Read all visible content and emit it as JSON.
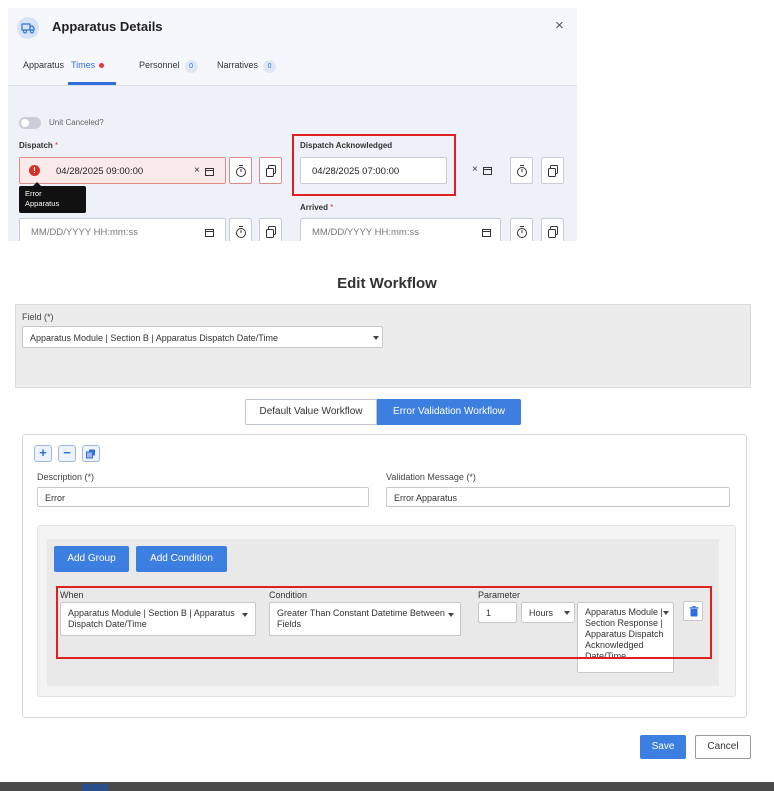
{
  "apparatus_details": {
    "title": "Apparatus Details",
    "close_glyph": "×",
    "tabs": [
      {
        "label": "Apparatus"
      },
      {
        "label": "Times"
      },
      {
        "label": "Personnel",
        "badge": "0"
      },
      {
        "label": "Narratives",
        "badge": "0"
      }
    ],
    "unit_canceled_label": "Unit Canceled?",
    "dispatch": {
      "label": "Dispatch",
      "required_mark": "*",
      "value": "04/28/2025 09:00:00",
      "clear": "×"
    },
    "dispatch_acknowledged": {
      "label": "Dispatch Acknowledged",
      "value": "04/28/2025 07:00:00",
      "clear": "×"
    },
    "tooltip": {
      "line1": "Error",
      "line2": "Apparatus"
    },
    "arrived": {
      "label": "Arrived",
      "required_mark": "*",
      "placeholder": "MM/DD/YYYY HH:mm:ss"
    },
    "left_row2": {
      "placeholder": "MM/DD/YYYY HH:mm:ss"
    }
  },
  "edit_workflow": {
    "title": "Edit Workflow",
    "field_label": "Field (*)",
    "field_value": "Apparatus Module | Section B | Apparatus Dispatch Date/Time",
    "toggle": {
      "default_label": "Default Value Workflow",
      "error_label": "Error Validation Workflow",
      "selected": "Error Validation Workflow"
    },
    "toolbar": {
      "add": "+",
      "remove": "−"
    },
    "description_label": "Description (*)",
    "description_value": "Error",
    "validation_label": "Validation Message (*)",
    "validation_value": "Error Apparatus",
    "add_group_label": "Add Group",
    "add_condition_label": "Add Condition",
    "condition_row": {
      "when_label": "When",
      "when_line1": "Apparatus Module | Section B | Apparatus",
      "when_line2": "Dispatch Date/Time",
      "condition_label": "Condition",
      "condition_line1": "Greater Than Constant Datetime Between",
      "condition_line2": "Fields",
      "parameter_label": "Parameter",
      "parameter_value": "1",
      "unit_value": "Hours",
      "target_lines": [
        "Apparatus Module |",
        "Section Response |",
        "Apparatus Dispatch",
        "Acknowledged",
        "Date/Time"
      ]
    },
    "save_label": "Save",
    "cancel_label": "Cancel"
  },
  "colors": {
    "accent": "#3d7fe0",
    "error_red": "#e02020",
    "panel_bg": "#eef1f7"
  }
}
